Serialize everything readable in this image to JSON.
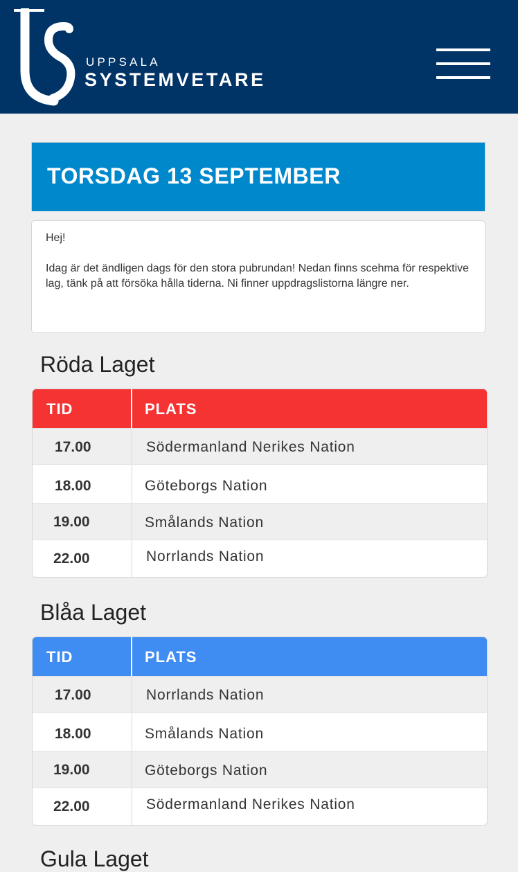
{
  "header": {
    "logo_small": "UPPSALA",
    "logo_big": "SYSTEMVETARE",
    "menu_icon": "hamburger-menu-icon",
    "background": "#003366"
  },
  "banner": {
    "title": "TORSDAG 13 SEPTEMBER",
    "color": "#0088cc"
  },
  "intro": {
    "greeting": "Hej!",
    "text": "Idag är det ändligen dags för den stora pubrundan! Nedan finns scehma för respektive lag, tänk på att försöka hålla tiderna. Ni finner uppdragslistorna längre ner."
  },
  "teams": [
    {
      "name": "Röda Laget",
      "color": "#f53333",
      "col_time": "TID",
      "col_place": "PLATS",
      "rows": [
        {
          "time": "17.00",
          "place": "Södermanland Nerikes Nation"
        },
        {
          "time": "18.00",
          "place": "Göteborgs Nation"
        },
        {
          "time": "19.00",
          "place": "Smålands Nation"
        },
        {
          "time": "22.00",
          "place": "Norrlands Nation"
        }
      ]
    },
    {
      "name": "Blåa Laget",
      "color": "#3f8cf3",
      "col_time": "TID",
      "col_place": "PLATS",
      "rows": [
        {
          "time": "17.00",
          "place": "Norrlands Nation"
        },
        {
          "time": "18.00",
          "place": "Smålands Nation"
        },
        {
          "time": "19.00",
          "place": "Göteborgs Nation"
        },
        {
          "time": "22.00",
          "place": "Södermanland Nerikes Nation"
        }
      ]
    },
    {
      "name": "Gula Laget"
    }
  ]
}
